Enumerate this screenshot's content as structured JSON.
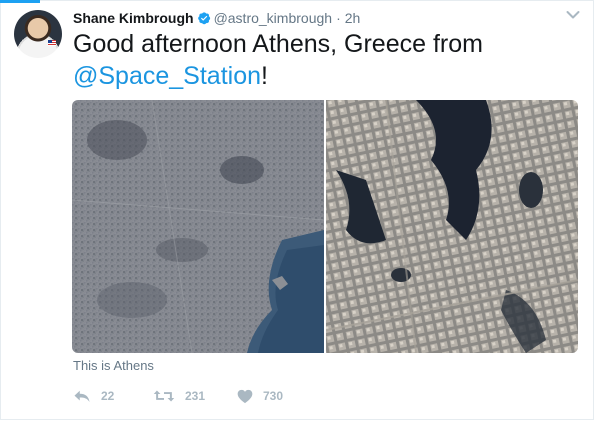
{
  "tweet": {
    "author_name": "Shane Kimbrough",
    "handle": "@astro_kimbrough",
    "separator": "·",
    "time": "2h",
    "text_prefix": "Good afternoon Athens, Greece from ",
    "mention": "@Space_Station",
    "text_suffix": "!",
    "caption": "This is Athens",
    "verified": true
  },
  "actions": {
    "reply_count": "22",
    "retweet_count": "231",
    "like_count": "730"
  },
  "icons": {
    "verified": "verified-badge-icon",
    "more": "chevron-down-icon",
    "reply": "reply-icon",
    "retweet": "retweet-icon",
    "like": "heart-icon"
  },
  "colors": {
    "accent": "#1da1f2",
    "mention": "#1b95e0",
    "muted": "#657786",
    "action": "#aab8c2"
  }
}
